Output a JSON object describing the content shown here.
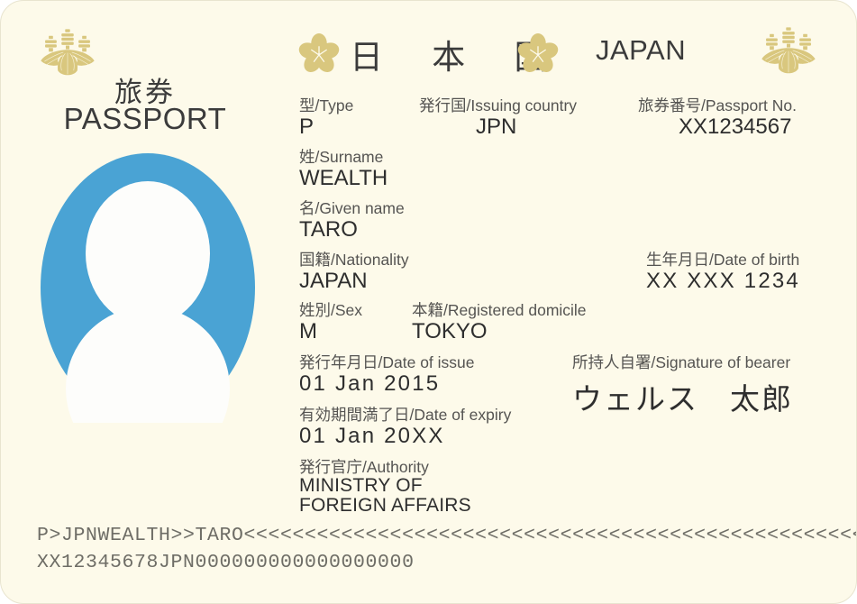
{
  "document": {
    "kind": "japan-passport-specimen",
    "background_color": "#fdfaea",
    "crest_color": "#d9c77e",
    "photo_color": "#4aa3d4",
    "title_jp": "旅券",
    "title_en": "PASSPORT",
    "country_jp": "日 本 国",
    "country_en": "JAPAN"
  },
  "fields": {
    "type": {
      "label": "型/Type",
      "value": "P"
    },
    "issuing_country": {
      "label": "発行国/Issuing country",
      "value": "JPN"
    },
    "passport_no": {
      "label": "旅券番号/Passport No.",
      "value": "XX1234567"
    },
    "surname": {
      "label": "姓/Surname",
      "value": "WEALTH"
    },
    "given_name": {
      "label": "名/Given name",
      "value": "TARO"
    },
    "nationality": {
      "label": "国籍/Nationality",
      "value": "JAPAN"
    },
    "date_of_birth": {
      "label": "生年月日/Date of birth",
      "value": "XX XXX 1234"
    },
    "sex": {
      "label": "姓別/Sex",
      "value": "M"
    },
    "registered_domicile": {
      "label": "本籍/Registered domicile",
      "value": "TOKYO"
    },
    "date_of_issue": {
      "label": "発行年月日/Date of issue",
      "value": "01 Jan 2015"
    },
    "date_of_expiry": {
      "label": "有効期間満了日/Date of expiry",
      "value": "01 Jan 20XX"
    },
    "authority": {
      "label": "発行官庁/Authority",
      "value_line1": "MINISTRY OF",
      "value_line2": "FOREIGN AFFAIRS"
    },
    "signature": {
      "label": "所持人自署/Signature of bearer",
      "value": "ウェルス　太郎"
    }
  },
  "mrz": {
    "line1": "P>JPNWEALTH>>TARO<<<<<<<<<<<<<<<<<<<<<<<<<<<<<<<<<<<<<<<<<<<<<<<<<<<<<<<<<<<<<<<<",
    "line2": "XX12345678JPN000000000000000000"
  }
}
